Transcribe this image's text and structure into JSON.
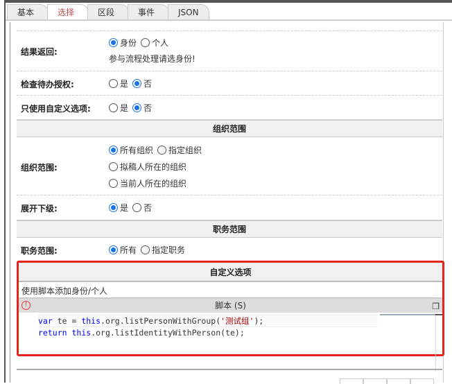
{
  "tabs": [
    "基本",
    "选择",
    "区段",
    "事件",
    "JSON"
  ],
  "active_tab": "选择",
  "rows": {
    "result": {
      "label": "结果返回:",
      "options": [
        "身份",
        "个人"
      ],
      "selected": "身份",
      "hint": "参与流程处理请选身份!"
    },
    "check": {
      "label": "检查待办授权:",
      "options": [
        "是",
        "否"
      ],
      "selected": "否"
    },
    "custom_only": {
      "label": "只使用自定义选项:",
      "options": [
        "是",
        "否"
      ],
      "selected": "否"
    }
  },
  "org_section": {
    "title": "组织范围",
    "label": "组织范围:",
    "options": [
      "所有组织",
      "指定组织",
      "拟稿人所在的组织",
      "当前人所在的组织"
    ],
    "selected": "所有组织",
    "expand": {
      "label": "展开下级:",
      "options": [
        "是",
        "否"
      ],
      "selected": "是"
    }
  },
  "duty_section": {
    "title": "职务范围",
    "label": "职务范围:",
    "options": [
      "所有",
      "指定职务"
    ],
    "selected": "所有"
  },
  "custom_section": {
    "title": "自定义选项",
    "desc": "使用脚本添加身份/个人",
    "script_title": "脚本 (S)",
    "code": {
      "l1a": "var",
      "l1b": " te = ",
      "l1c": "this",
      "l1d": ".org.listPersonWithGroup(",
      "l1e": "'测试组'",
      "l1f": ");",
      "l2a": "return",
      "l2b": " ",
      "l2c": "this",
      "l2d": ".org.listIdentityWithPerson(te);"
    }
  }
}
